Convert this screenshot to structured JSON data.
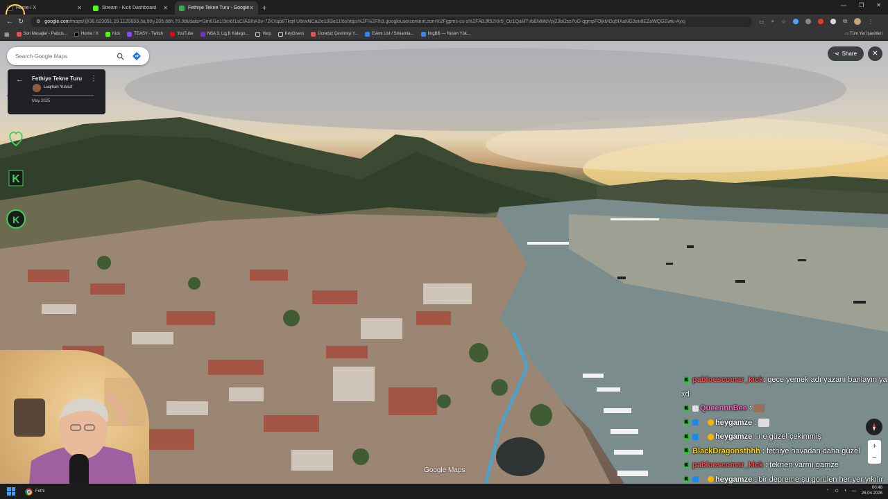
{
  "browser": {
    "tabs": [
      {
        "title": "Home / X",
        "color": "#e8eaed",
        "active": false
      },
      {
        "title": "Stream - Kick Dashboard",
        "color": "#53fc18",
        "active": false
      },
      {
        "title": "Fethiye Tekne Turu - Google M...",
        "color": "#34a853",
        "active": true
      }
    ],
    "new_tab": "+",
    "url_host": "google.com",
    "url_path": "/maps/@36.623051,29.1120659,3a,90y,205.88h,70.08t/data=!3m8!1e1!3m6!1sCIABIhA3v-72KXqb8Tkqil U8rwNCai2e10l3e11!6shttps%2F%2Flh3.googleusercontent.com%2Fgpms-cs-s%2FABJlf52Xir5_Oz1QaMTvbBMMdVpj23bi2ss7oO-qgmpFOjkMOq5IXaNG2en8EZaWQGEwki-Aycj",
    "bookmarks": [
      {
        "label": "Son Mesajlar - Pabcis...",
        "color": "#d9534f"
      },
      {
        "label": "Home / X",
        "color": "#e8eaed"
      },
      {
        "label": "Kick",
        "color": "#53fc18"
      },
      {
        "label": "TEASY - Twitch",
        "color": "#9146ff"
      },
      {
        "label": "YouTube",
        "color": "#ff0000"
      },
      {
        "label": "NBA 3. Lig B Katego...",
        "color": "#7b2fc0"
      },
      {
        "label": "Vorp",
        "color": "#f2c94c"
      },
      {
        "label": "KeyGivers",
        "color": "#f2c94c"
      },
      {
        "label": "Ücretsiz Çevirmişi Y...",
        "color": "#d9534f"
      },
      {
        "label": "Event List / Streamla...",
        "color": "#3b82f6"
      },
      {
        "label": "ImgBB — Resim Yük...",
        "color": "#3b82f6"
      }
    ],
    "bookmarks_right": "Tüm Yer İşaretleri"
  },
  "maps": {
    "search_placeholder": "Search Google Maps",
    "card_title": "Fethiye Tekne Turu",
    "author": "Luqman Yussuf",
    "date": "May 2025",
    "share_label": "Share",
    "close_label": "✕",
    "logo": "Google Maps"
  },
  "chat": [
    {
      "user": "pabloescomar_kick",
      "user_color": "#ff4d4d",
      "message": ": gece yemek adı yazanı banlayın ya",
      "badges": []
    },
    {
      "user": "",
      "user_color": "#ffffff",
      "message": "xd",
      "badges": [],
      "continuation": true
    },
    {
      "user": "QueennnBee",
      "user_color": "#ff69b4",
      "message": " :",
      "badges": [
        "crown"
      ],
      "emote": true
    },
    {
      "user": "heygamze",
      "user_color": "#ffffff",
      "message": " :",
      "badges": [
        "blue",
        "rocket",
        "gold"
      ],
      "emote": true
    },
    {
      "user": "heygamze",
      "user_color": "#ffffff",
      "message": " : ne güzel çekimmiş",
      "badges": [
        "blue",
        "rocket",
        "gold"
      ]
    },
    {
      "user": "BlackDragonsthhh",
      "user_color": "#ffd700",
      "message": " : fethiye havadan daha güzel",
      "badges": []
    },
    {
      "user": "pabloescomar_kick",
      "user_color": "#ff4d4d",
      "message": " : teknen varmı gamze",
      "badges": []
    },
    {
      "user": "heygamze",
      "user_color": "#ffffff",
      "message": " : bir depreme şu görülen her yer yıkılır",
      "badges": [
        "blue",
        "rocket",
        "gold"
      ]
    }
  ],
  "taskbar": {
    "app_label": "Fethi",
    "time": "00:48",
    "date": "26.04.2026"
  }
}
